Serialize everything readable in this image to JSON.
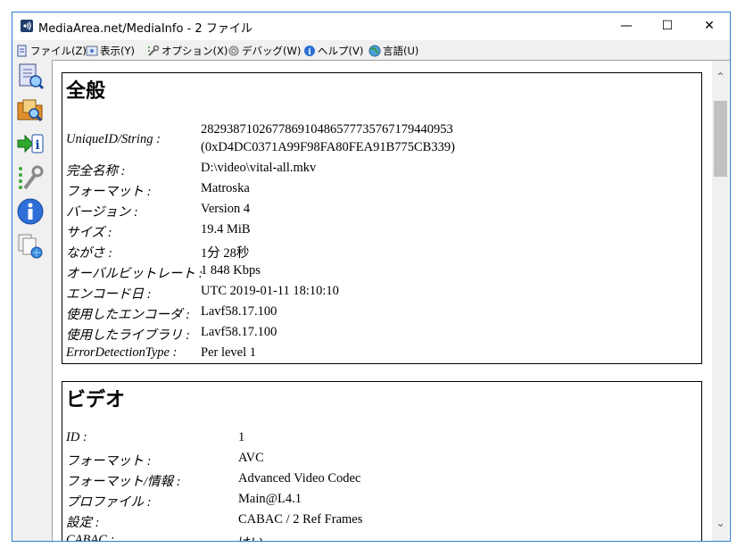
{
  "window": {
    "title": "MediaArea.net/MediaInfo - 2 ファイル",
    "controls": {
      "minimize": "—",
      "maximize": "☐",
      "close": "✕"
    }
  },
  "menu": [
    {
      "label": "ファイル(Z)",
      "icon": "file-icon"
    },
    {
      "label": "表示(Y)",
      "icon": "view-icon"
    },
    {
      "label": "オプション(X)",
      "icon": "options-icon"
    },
    {
      "label": "デバッグ(W)",
      "icon": "debug-icon"
    },
    {
      "label": "ヘルプ(V)",
      "icon": "help-icon"
    },
    {
      "label": "言語(U)",
      "icon": "language-icon"
    }
  ],
  "sidebar": [
    {
      "icon": "open-file-icon"
    },
    {
      "icon": "open-folder-icon"
    },
    {
      "icon": "export-info-icon"
    },
    {
      "icon": "preferences-icon"
    },
    {
      "icon": "about-icon"
    },
    {
      "icon": "web-update-icon"
    }
  ],
  "sections": {
    "general": {
      "heading": "全般",
      "rows": [
        {
          "key": "UniqueID/String :",
          "value": "282938710267786910486577735767179440953"
        },
        {
          "key": "",
          "value": "(0xD4DC0371A99F98FA80FEA91B775CB339)"
        },
        {
          "key": "完全名称 :",
          "value": "D:\\video\\vital-all.mkv"
        },
        {
          "key": "フォーマット :",
          "value": "Matroska"
        },
        {
          "key": "バージョン :",
          "value": "Version 4"
        },
        {
          "key": "サイズ :",
          "value": "19.4 MiB"
        },
        {
          "key": "ながさ :",
          "value": "1分 28秒"
        },
        {
          "key": "オーバルビットレート :",
          "value": "1 848 Kbps"
        },
        {
          "key": "エンコード日 :",
          "value": "UTC 2019-01-11 18:10:10"
        },
        {
          "key": "使用したエンコーダ :",
          "value": "Lavf58.17.100"
        },
        {
          "key": "使用したライブラリ :",
          "value": "Lavf58.17.100"
        },
        {
          "key": "ErrorDetectionType :",
          "value": "Per level 1"
        }
      ]
    },
    "video": {
      "heading": "ビデオ",
      "rows": [
        {
          "key": "ID :",
          "value": "1"
        },
        {
          "key": "フォーマット :",
          "value": "AVC"
        },
        {
          "key": "フォーマット/情報 :",
          "value": "Advanced Video Codec"
        },
        {
          "key": "プロファイル :",
          "value": "Main@L4.1"
        },
        {
          "key": "設定 :",
          "value": "CABAC / 2 Ref Frames"
        },
        {
          "key": "CABAC :",
          "value": "はい"
        }
      ]
    }
  },
  "scrollbar": {
    "up": "⌃",
    "down": "⌄"
  }
}
